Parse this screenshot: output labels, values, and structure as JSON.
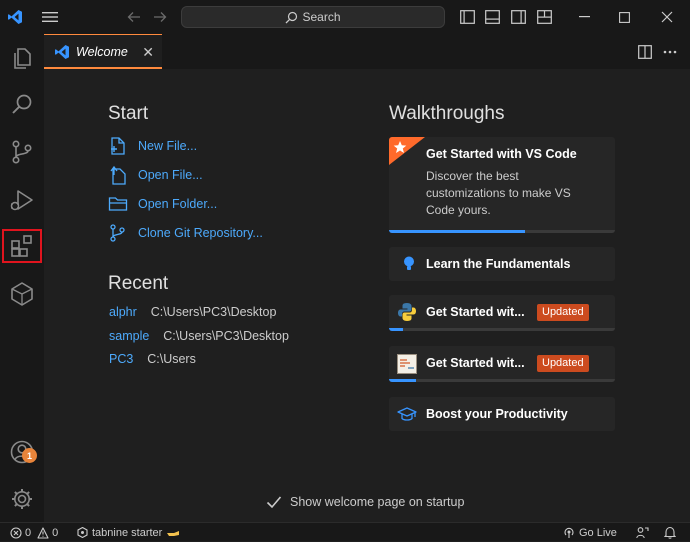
{
  "titlebar": {
    "search_label": "Search"
  },
  "activity_bar": {
    "items": [
      "explorer-icon",
      "search-icon",
      "source-control-icon",
      "run-debug-icon",
      "extensions-icon",
      "remote-icon"
    ],
    "accounts_badge": "1"
  },
  "tabs": [
    {
      "label": "Welcome",
      "close": "✕"
    }
  ],
  "welcome": {
    "start_heading": "Start",
    "start_items": [
      {
        "label": "New File..."
      },
      {
        "label": "Open File..."
      },
      {
        "label": "Open Folder..."
      },
      {
        "label": "Clone Git Repository..."
      }
    ],
    "recent_heading": "Recent",
    "recent_items": [
      {
        "name": "alphr",
        "path": "C:\\Users\\PC3\\Desktop"
      },
      {
        "name": "sample",
        "path": "C:\\Users\\PC3\\Desktop"
      },
      {
        "name": "PC3",
        "path": "C:\\Users"
      }
    ],
    "walkthroughs_heading": "Walkthroughs",
    "walkthroughs": [
      {
        "title": "Get Started with VS Code",
        "description": "Discover the best customizations to make VS Code yours.",
        "progress": 0.6
      },
      {
        "title": "Learn the Fundamentals",
        "progress": 0
      },
      {
        "title": "Get Started wit...",
        "badge": "Updated",
        "progress": 0.06
      },
      {
        "title": "Get Started wit...",
        "badge": "Updated",
        "progress": 0.12
      },
      {
        "title": "Boost your Productivity",
        "progress": 0
      }
    ],
    "show_on_startup_label": "Show welcome page on startup",
    "show_on_startup_checked": true
  },
  "statusbar": {
    "errors": "0",
    "warnings": "0",
    "tabnine": "tabnine starter",
    "go_live": "Go Live"
  },
  "colors": {
    "accent": "#3794ff",
    "link": "#4daafc",
    "tab_highlight": "#ff8a3d",
    "badge": "#cc4b1f",
    "selection_outline": "#e0141e"
  }
}
